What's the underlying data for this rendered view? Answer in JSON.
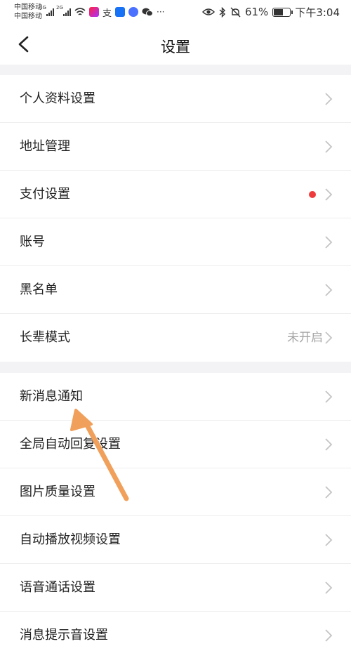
{
  "status_bar": {
    "carrier_1": "中国移动",
    "carrier_2": "中国移动",
    "sig1_label": "4G",
    "sig2_label": "2G",
    "battery_text": "61%",
    "battery_level": 0.61,
    "time": "下午3:04",
    "more": "···"
  },
  "header": {
    "title": "设置"
  },
  "groups": [
    {
      "rows": [
        {
          "label": "个人资料设置"
        },
        {
          "label": "地址管理"
        },
        {
          "label": "支付设置",
          "badge": true
        },
        {
          "label": "账号"
        },
        {
          "label": "黑名单"
        },
        {
          "label": "长辈模式",
          "value": "未开启"
        }
      ]
    },
    {
      "rows": [
        {
          "label": "新消息通知"
        },
        {
          "label": "全局自动回复设置"
        },
        {
          "label": "图片质量设置"
        },
        {
          "label": "自动播放视频设置"
        },
        {
          "label": "语音通话设置"
        },
        {
          "label": "消息提示音设置"
        }
      ]
    }
  ],
  "colors": {
    "background_gap": "#f3f3f5",
    "badge_red": "#ef3b3b",
    "annotation_arrow": "#f0a05a",
    "chevron": "#c4c4c4"
  }
}
